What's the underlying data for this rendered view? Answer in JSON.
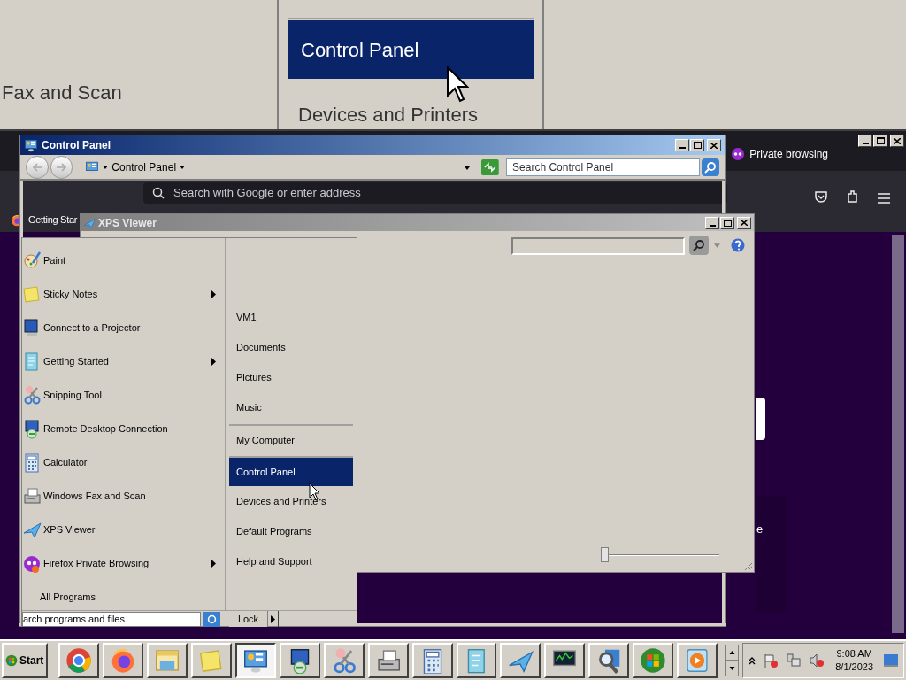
{
  "magnifier": {
    "items": [
      {
        "label": "Fax and Scan",
        "selected": false
      },
      {
        "label": "Control Panel",
        "selected": true
      },
      {
        "label": "Devices and Printers",
        "selected": false
      }
    ]
  },
  "browser": {
    "bookmark": "Getting Star",
    "private_label": "Private browsing",
    "address_placeholder": "Search with Google or enter address",
    "page_text": "e"
  },
  "control_panel": {
    "title": "Control Panel",
    "breadcrumb": "Control Panel",
    "search_placeholder": "Search Control Panel"
  },
  "xps_viewer": {
    "title": "XPS Viewer",
    "zoom": {
      "level": 0
    }
  },
  "start_menu": {
    "programs": [
      {
        "label": "Paint",
        "kind": "paint",
        "submenu": false
      },
      {
        "label": "Sticky Notes",
        "kind": "sticky",
        "submenu": true
      },
      {
        "label": "Connect to a Projector",
        "kind": "projector",
        "submenu": false
      },
      {
        "label": "Getting Started",
        "kind": "document",
        "submenu": true
      },
      {
        "label": "Snipping Tool",
        "kind": "scissors",
        "submenu": false
      },
      {
        "label": "Remote Desktop Connection",
        "kind": "remote",
        "submenu": false
      },
      {
        "label": "Calculator",
        "kind": "calculator",
        "submenu": false
      },
      {
        "label": "Windows Fax and Scan",
        "kind": "fax",
        "submenu": false
      },
      {
        "label": "XPS Viewer",
        "kind": "plane",
        "submenu": false
      },
      {
        "label": "Firefox Private Browsing",
        "kind": "mask",
        "submenu": true
      }
    ],
    "all_programs": "All Programs",
    "places": [
      {
        "label": "VM1",
        "separator_before": false,
        "selected": false
      },
      {
        "label": "Documents",
        "separator_before": false,
        "selected": false
      },
      {
        "label": "Pictures",
        "separator_before": false,
        "selected": false
      },
      {
        "label": "Music",
        "separator_before": false,
        "selected": false
      },
      {
        "label": "My Computer",
        "separator_before": true,
        "selected": false
      },
      {
        "label": "Control Panel",
        "separator_before": true,
        "selected": true
      },
      {
        "label": "Devices and Printers",
        "separator_before": false,
        "selected": false
      },
      {
        "label": "Default Programs",
        "separator_before": false,
        "selected": false
      },
      {
        "label": "Help and Support",
        "separator_before": false,
        "selected": false
      }
    ],
    "search_value": "arch programs and files",
    "lock": "Lock"
  },
  "taskbar": {
    "start": "Start",
    "buttons": [
      {
        "kind": "chrome",
        "pressed": false
      },
      {
        "kind": "firefox",
        "pressed": false
      },
      {
        "kind": "explorer",
        "pressed": false
      },
      {
        "kind": "sticky",
        "pressed": false
      },
      {
        "kind": "controlpanel",
        "pressed": true
      },
      {
        "kind": "remote",
        "pressed": false
      },
      {
        "kind": "scissors",
        "pressed": false
      },
      {
        "kind": "fax",
        "pressed": false
      },
      {
        "kind": "calculator",
        "pressed": false
      },
      {
        "kind": "document",
        "pressed": false
      },
      {
        "kind": "plane",
        "pressed": false
      },
      {
        "kind": "monitor",
        "pressed": false
      },
      {
        "kind": "magnifier",
        "pressed": false
      },
      {
        "kind": "orb",
        "pressed": false
      },
      {
        "kind": "media",
        "pressed": false
      }
    ],
    "time": "9:08 AM",
    "date": "8/1/2023"
  }
}
